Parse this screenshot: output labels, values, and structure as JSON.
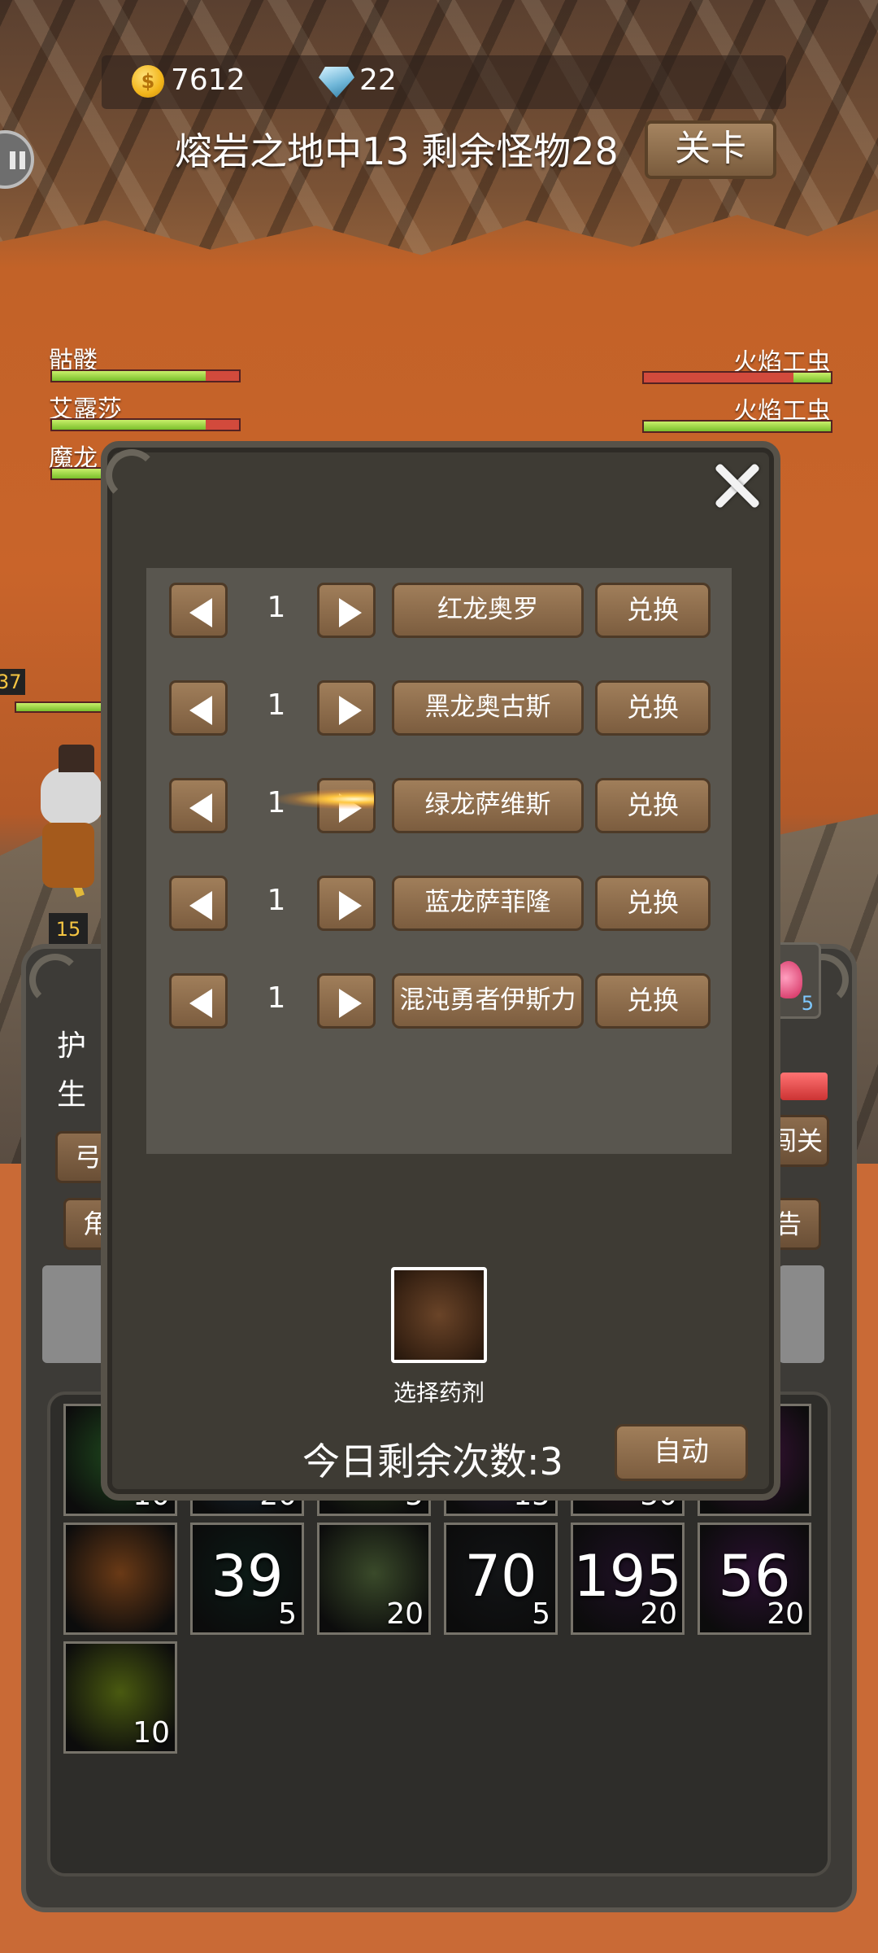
{
  "currency": {
    "gold": "7612",
    "diamonds": "22"
  },
  "stage": {
    "title": "熔岩之地中13 剩余怪物28",
    "level_button": "关卡"
  },
  "allies": [
    {
      "name": "骷髅",
      "hp": 0.82
    },
    {
      "name": "艾露莎",
      "hp": 0.82
    },
    {
      "name": "魔龙",
      "hp": 0.82
    }
  ],
  "enemies": [
    {
      "name": "火焰工虫",
      "hp": 0.2
    },
    {
      "name": "火焰工虫",
      "hp": 1.0
    }
  ],
  "hero": {
    "level": "15",
    "side_value": "37"
  },
  "background_panel": {
    "labels": [
      "护",
      "生",
      "弓",
      "角"
    ],
    "buttons_right": [
      "闯关",
      "告"
    ],
    "potion_count": "5"
  },
  "exchange_dialog": {
    "rows": [
      {
        "qty": "1",
        "name": "红龙奥罗",
        "action": "兑换"
      },
      {
        "qty": "1",
        "name": "黑龙奥古斯",
        "action": "兑换"
      },
      {
        "qty": "1",
        "name": "绿龙萨维斯",
        "action": "兑换"
      },
      {
        "qty": "1",
        "name": "蓝龙萨菲隆",
        "action": "兑换"
      },
      {
        "qty": "1",
        "name": "混沌勇者伊斯力",
        "action": "兑换"
      }
    ],
    "potion_label": "选择药剂",
    "remaining_text": "今日剩余次数:3",
    "auto_button": "自动"
  },
  "skills": [
    {
      "big": "",
      "small": "10",
      "color": "#1f4a1e"
    },
    {
      "big": "",
      "small": "20",
      "color": "#1a2f3e"
    },
    {
      "big": "",
      "small": "5",
      "color": "#2a3a1a"
    },
    {
      "big": "",
      "small": "15",
      "color": "#2a1f3a"
    },
    {
      "big": "",
      "small": "30",
      "color": "#2a1520"
    },
    {
      "big": "",
      "small": "",
      "color": "#3a1238"
    },
    {
      "big": "",
      "small": "",
      "color": "#6a3a16"
    },
    {
      "big": "39",
      "small": "5",
      "color": "#0c1a16"
    },
    {
      "big": "",
      "small": "20",
      "color": "#3a4a2a"
    },
    {
      "big": "70",
      "small": "5",
      "color": "#121416"
    },
    {
      "big": "195",
      "small": "20",
      "color": "#1e1024"
    },
    {
      "big": "56",
      "small": "20",
      "color": "#2a1030"
    },
    {
      "big": "",
      "small": "10",
      "color": "#4a5a10"
    }
  ]
}
